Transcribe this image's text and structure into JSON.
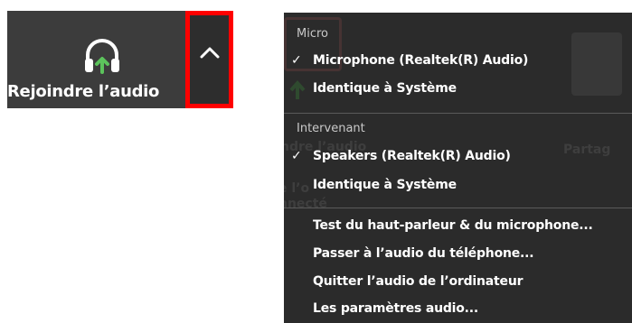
{
  "toolbar": {
    "join_audio_label": "Rejoindre l’audio",
    "accent_color": "#5cc35c",
    "highlight_color": "#ff0000"
  },
  "background": {
    "ghost_join_audio": "ndre l’audio",
    "ghost_connected_1": "e l’o",
    "ghost_connected_2": "nnecté",
    "ghost_share": "Partag"
  },
  "menu": {
    "sections": [
      {
        "header": "Micro",
        "items": [
          {
            "label": "Microphone (Realtek(R) Audio)",
            "checked": true
          },
          {
            "label": "Identique à Système",
            "checked": false
          }
        ]
      },
      {
        "header": "Intervenant",
        "items": [
          {
            "label": "Speakers (Realtek(R) Audio)",
            "checked": true
          },
          {
            "label": "Identique à Système",
            "checked": false
          }
        ]
      }
    ],
    "actions": [
      "Test du haut-parleur & du microphone...",
      "Passer à l’audio du téléphone...",
      "Quitter l’audio de l’ordinateur",
      "Les paramètres audio..."
    ],
    "check_mark": "✓"
  }
}
